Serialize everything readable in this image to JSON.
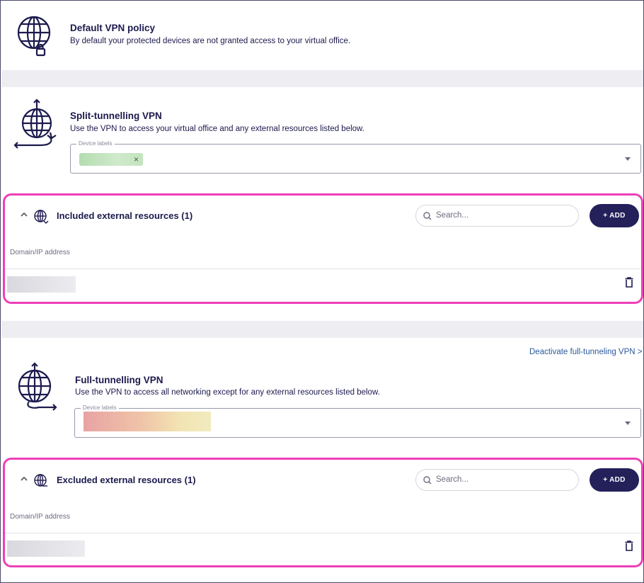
{
  "default_policy": {
    "title": "Default VPN policy",
    "description": "By default your protected devices are not granted access to your virtual office."
  },
  "split_tunnelling": {
    "title": "Split-tunnelling VPN",
    "description": "Use the VPN to access your virtual office and any external resources listed below.",
    "device_labels_legend": "Device labels",
    "chip_remove": "×"
  },
  "included_panel": {
    "title": "Included external resources (1)",
    "search_placeholder": "Search...",
    "add_label": "+ ADD",
    "column_header": "Domain/IP address"
  },
  "deactivate_link": "Deactivate full-tunneling VPN >",
  "full_tunnelling": {
    "title": "Full-tunnelling VPN",
    "description": "Use the VPN to access all networking except for any external resources listed below.",
    "device_labels_legend": "Device labels"
  },
  "excluded_panel": {
    "title": "Excluded external resources (1)",
    "search_placeholder": "Search...",
    "add_label": "+ ADD",
    "column_header": "Domain/IP address"
  },
  "colors": {
    "text": "#1c1a4d",
    "accent_button": "#24205a",
    "highlight_border": "#ee3fb8",
    "link": "#2b5a9a"
  }
}
